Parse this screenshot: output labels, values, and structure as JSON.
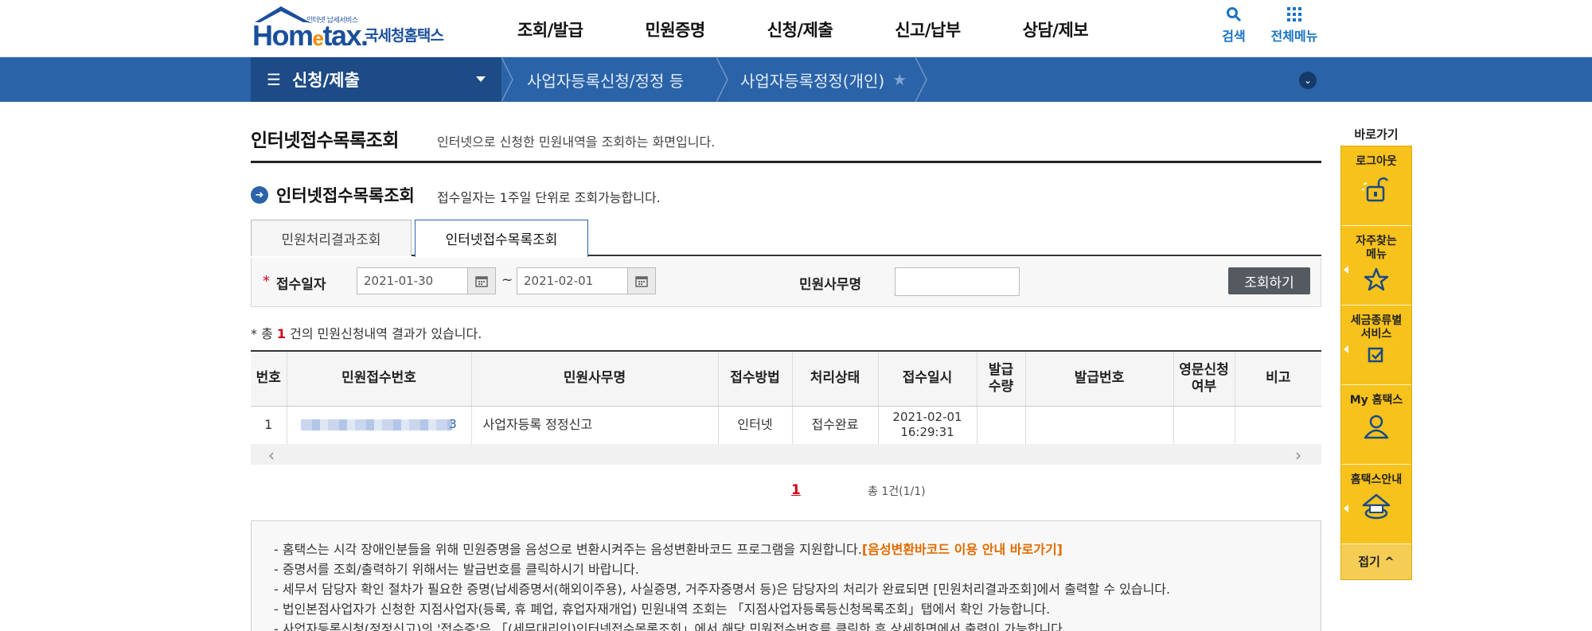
{
  "header": {
    "logo_sub": "인터넷 납세서비스",
    "logo_text_pre": "Hom",
    "logo_text_e": "e",
    "logo_text_post": "tax.",
    "logo_kr": "국세청홈택스",
    "gnb": [
      "조회/발급",
      "민원증명",
      "신청/제출",
      "신고/납부",
      "상담/제보"
    ],
    "search_label": "검색",
    "allmenu_label": "전체메뉴"
  },
  "navbar": {
    "menu_label": "신청/제출",
    "crumbs": [
      "사업자등록신청/정정 등",
      "사업자등록정정(개인)"
    ]
  },
  "page": {
    "title": "인터넷접수목록조회",
    "desc": "인터넷으로 신청한 민원내역을 조회하는 화면입니다."
  },
  "section": {
    "title": "인터넷접수목록조회",
    "desc": "접수일자는 1주일 단위로 조회가능합니다."
  },
  "tabs": [
    "민원처리결과조회",
    "인터넷접수목록조회"
  ],
  "search": {
    "required_mark": "*",
    "date_label": "접수일자",
    "date_from": "2021-01-30",
    "date_to": "2021-02-01",
    "tilde": "~",
    "name_label": "민원사무명",
    "name_value": "",
    "button": "조회하기"
  },
  "summary": {
    "pre": "* 총",
    "count": "1",
    "post": "건의 민원신청내역 결과가 있습니다."
  },
  "table": {
    "headers": [
      "번호",
      "민원접수번호",
      "민원사무명",
      "접수방법",
      "처리상태",
      "접수일시",
      "발급\n수량",
      "발급번호",
      "영문신청\n여부",
      "비고"
    ],
    "rows": [
      {
        "no": "1",
        "receipt_tail": "3",
        "name": "사업자등록 정정신고",
        "method": "인터넷",
        "status": "접수완료",
        "date": "2021-02-01",
        "time": "16:29:31",
        "qty": "",
        "issue_no": "",
        "english": "",
        "note": ""
      }
    ]
  },
  "pager": {
    "current": "1",
    "total": "총 1건(1/1)"
  },
  "notice": {
    "line1": "- 홈택스는 시각 장애인분들을 위해 민원증명을 음성으로 변환시켜주는 음성변환바코드 프로그램을 지원합니다.",
    "line1_link": "[음성변환바코드 이용 안내 바로가기]",
    "line2": "- 증명서를 조회/출력하기 위해서는 발급번호를 클릭하시기 바랍니다.",
    "line3": "- 세무서 담당자 확인 절차가 필요한 증명(납세증명서(해외이주용), 사실증명, 거주자증명서 등)은 담당자의 처리가 완료되면 [민원처리결과조회]에서 출력할 수 있습니다.",
    "line4": "- 법인본점사업자가 신청한 지점사업자(등록, 휴 폐업, 휴업자재개업) 민원내역 조회는 「지점사업자등록등신청목록조회」탭에서 확인 가능합니다.",
    "line5": "- 사업자등록신청(정정신고)의 '접수증'은 「(세무대리인)인터넷접수목록조회」에서 해당 민원접수번호를 클릭한 후 상세화면에서 출력이 가능합니다."
  },
  "quick": {
    "title": "바로가기",
    "items": [
      "로그아웃",
      "자주찾는\n메뉴",
      "세금종류별\n서비스",
      "My 홈택스",
      "홈택스안내"
    ],
    "close": "접기 ^"
  },
  "colors": {
    "brand_blue": "#2b63a8",
    "nav_dark": "#1c4b86",
    "quick_yellow": "#f7c21c",
    "accent_red": "#d0021b",
    "link_orange": "#e06b00"
  }
}
